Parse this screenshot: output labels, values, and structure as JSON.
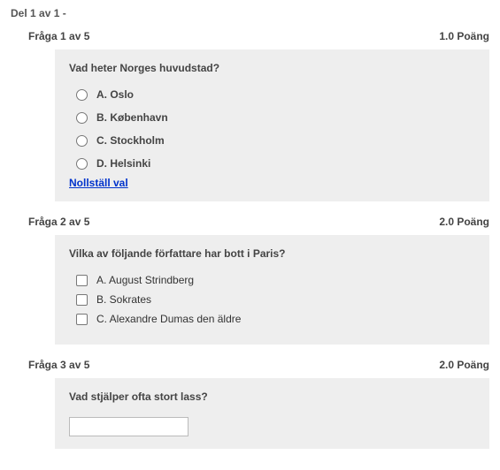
{
  "part_header": "Del 1 av 1 -",
  "questions": [
    {
      "header": "Fråga 1 av 5",
      "points": "1.0 Poäng",
      "text": "Vad heter Norges huvudstad?",
      "type": "radio",
      "options": [
        {
          "label": "A. Oslo"
        },
        {
          "label": "B. København"
        },
        {
          "label": "C. Stockholm"
        },
        {
          "label": "D. Helsinki"
        }
      ],
      "reset_label": "Nollställ val"
    },
    {
      "header": "Fråga 2 av 5",
      "points": "2.0 Poäng",
      "text": "Vilka av följande författare har bott i Paris?",
      "type": "checkbox",
      "options": [
        {
          "label": "A. August Strindberg"
        },
        {
          "label": "B. Sokrates"
        },
        {
          "label": "C. Alexandre Dumas den äldre"
        }
      ]
    },
    {
      "header": "Fråga 3 av 5",
      "points": "2.0 Poäng",
      "text": "Vad stjälper ofta stort lass?",
      "type": "text",
      "value": ""
    }
  ]
}
